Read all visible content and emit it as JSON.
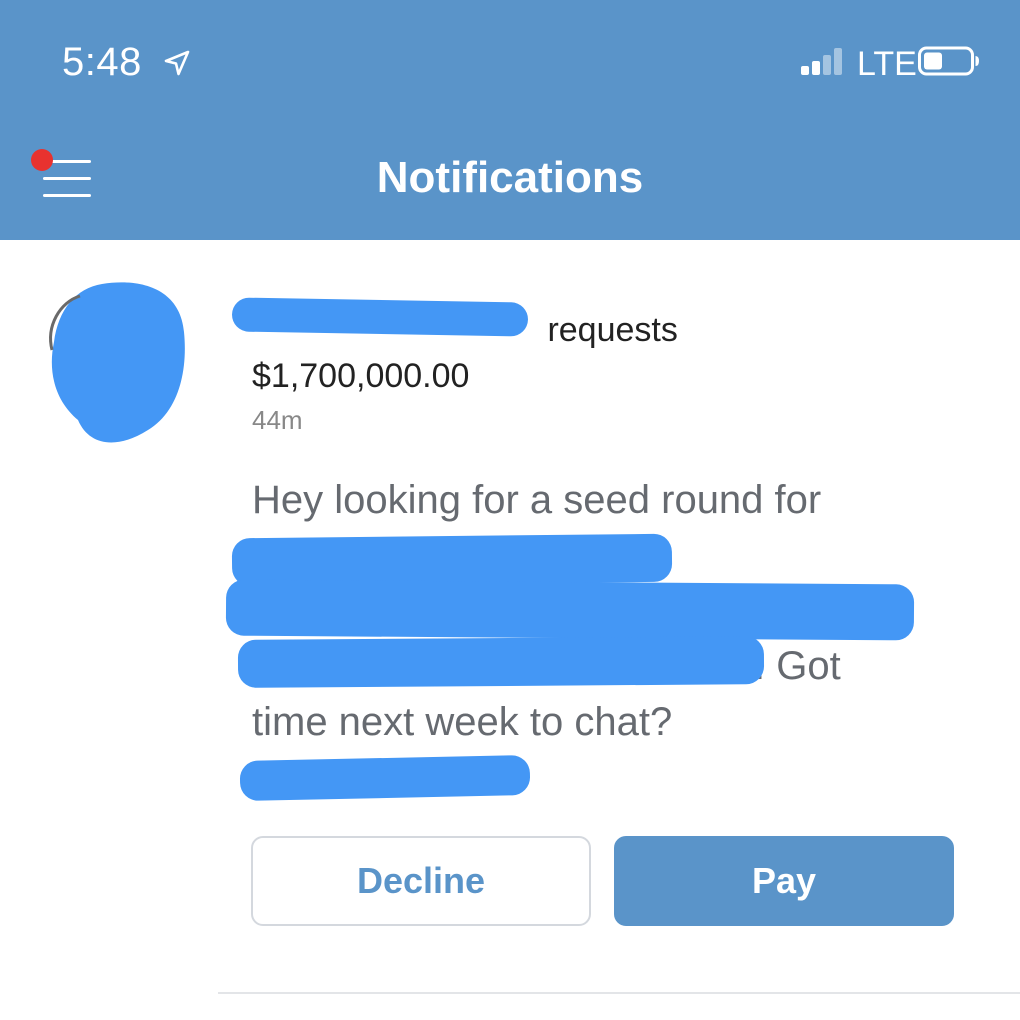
{
  "status_bar": {
    "time": "5:48",
    "network": "LTE",
    "location_icon": "location-arrow-icon",
    "signal_icon": "signal-bars-icon",
    "battery_icon": "battery-icon"
  },
  "header": {
    "title": "Notifications",
    "menu_icon": "hamburger-menu-icon",
    "has_unread_dot": true
  },
  "notification": {
    "action_text": "requests",
    "amount": "$1,700,000.00",
    "time_ago": "44m",
    "message_lines": [
      "Hey looking for a seed round for",
      ". Got",
      "time next week to chat?"
    ],
    "decline_label": "Decline",
    "pay_label": "Pay"
  },
  "colors": {
    "header_bg": "#5a94c9",
    "accent": "#5a94c9",
    "unread_dot": "#e8322f",
    "redaction": "#4497f5"
  }
}
